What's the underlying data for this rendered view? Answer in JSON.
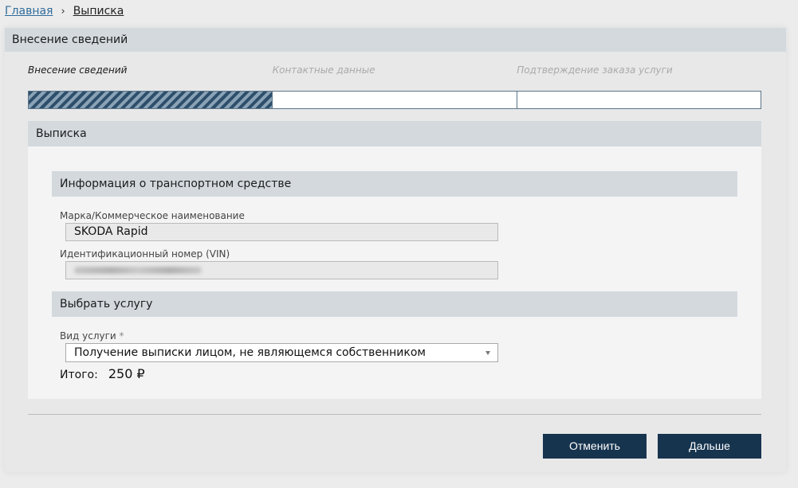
{
  "breadcrumb": {
    "home": "Главная",
    "separator": "›",
    "current": "Выписка"
  },
  "panel": {
    "title": "Внесение сведений"
  },
  "steps": [
    {
      "label": "Внесение сведений",
      "active": true
    },
    {
      "label": "Контактные данные",
      "active": false
    },
    {
      "label": "Подтверждение заказа услуги",
      "active": false
    }
  ],
  "section": {
    "title": "Выписка",
    "vehicle": {
      "title": "Информация о транспортном средстве",
      "make_label": "Марка/Коммерческое наименование",
      "make_value": "SKODA Rapid",
      "vin_label": "Идентификационный номер (VIN)"
    },
    "service": {
      "title": "Выбрать услугу",
      "type_label": "Вид услуги",
      "required_mark": "*",
      "type_value": "Получение выписки лицом, не являющемся собственником"
    },
    "total_label": "Итого:",
    "total_value": "250 ₽"
  },
  "buttons": {
    "cancel": "Отменить",
    "next": "Дальше"
  },
  "colors": {
    "primary_button": "#17344f",
    "header_bg": "#d3d9dd",
    "link": "#2f6c9c"
  }
}
